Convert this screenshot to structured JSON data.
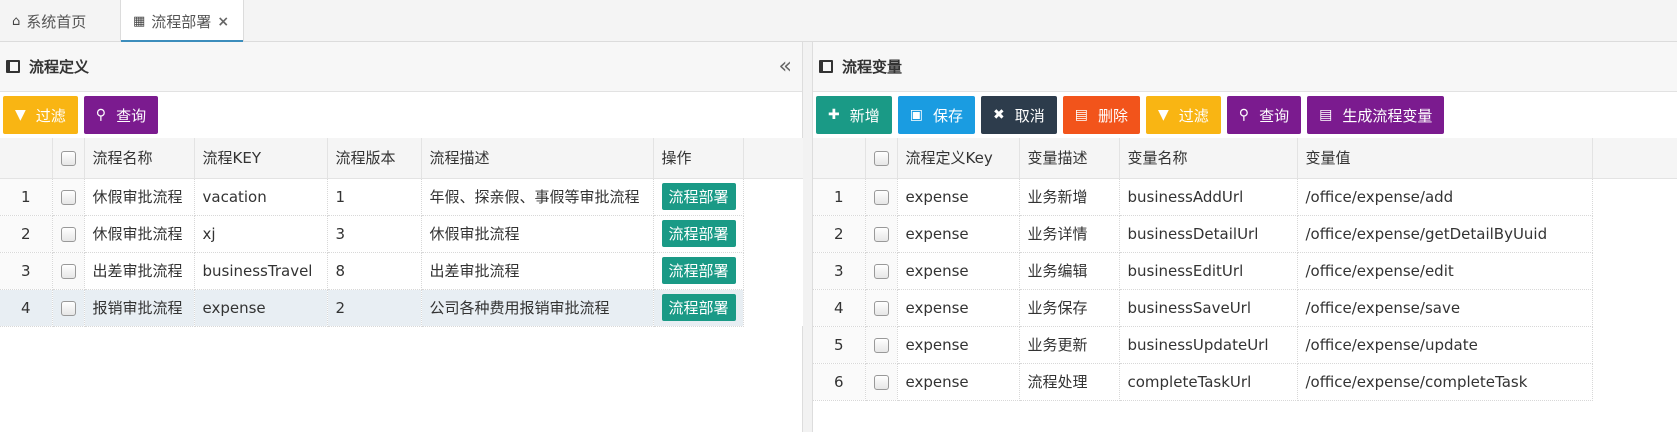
{
  "tabs": [
    {
      "label": "系统首页",
      "icon": "home-icon"
    },
    {
      "label": "流程部署",
      "icon": "sitemap-icon",
      "close": "×"
    }
  ],
  "left_panel": {
    "title": "流程定义",
    "collapse_symbol": "«",
    "buttons": [
      {
        "label": "过滤",
        "icon": "filter-icon",
        "color": "#f9b513"
      },
      {
        "label": "查询",
        "icon": "search-icon",
        "color": "#7b1b8f"
      }
    ],
    "columns": [
      "流程名称",
      "流程KEY",
      "流程版本",
      "流程描述",
      "操作"
    ],
    "rows": [
      {
        "no": "1",
        "name": "休假审批流程",
        "key": "vacation",
        "version": "1",
        "desc": "年假、探亲假、事假等审批流程",
        "action": "流程部署"
      },
      {
        "no": "2",
        "name": "休假审批流程",
        "key": "xj",
        "version": "3",
        "desc": "休假审批流程",
        "action": "流程部署"
      },
      {
        "no": "3",
        "name": "出差审批流程",
        "key": "businessTravel",
        "version": "8",
        "desc": "出差审批流程",
        "action": "流程部署"
      },
      {
        "no": "4",
        "name": "报销审批流程",
        "key": "expense",
        "version": "2",
        "desc": "公司各种费用报销审批流程",
        "action": "流程部署"
      }
    ]
  },
  "right_panel": {
    "title": "流程变量",
    "buttons": [
      {
        "label": "新增",
        "icon": "plus-icon",
        "color": "#1a9a86"
      },
      {
        "label": "保存",
        "icon": "save-icon",
        "color": "#1a9ce1"
      },
      {
        "label": "取消",
        "icon": "times-icon",
        "color": "#2d3c4c"
      },
      {
        "label": "删除",
        "icon": "file-icon",
        "color": "#f2541b"
      },
      {
        "label": "过滤",
        "icon": "filter-icon",
        "color": "#f9b513"
      },
      {
        "label": "查询",
        "icon": "search-icon",
        "color": "#7b1b8f"
      },
      {
        "label": "生成流程变量",
        "icon": "file-text-icon",
        "color": "#7b1b8f"
      }
    ],
    "columns": [
      "流程定义Key",
      "变量描述",
      "变量名称",
      "变量值"
    ],
    "rows": [
      {
        "no": "1",
        "def_key": "expense",
        "desc": "业务新增",
        "name": "businessAddUrl",
        "value": "/office/expense/add"
      },
      {
        "no": "2",
        "def_key": "expense",
        "desc": "业务详情",
        "name": "businessDetailUrl",
        "value": "/office/expense/getDetailByUuid"
      },
      {
        "no": "3",
        "def_key": "expense",
        "desc": "业务编辑",
        "name": "businessEditUrl",
        "value": "/office/expense/edit"
      },
      {
        "no": "4",
        "def_key": "expense",
        "desc": "业务保存",
        "name": "businessSaveUrl",
        "value": "/office/expense/save"
      },
      {
        "no": "5",
        "def_key": "expense",
        "desc": "业务更新",
        "name": "businessUpdateUrl",
        "value": "/office/expense/update"
      },
      {
        "no": "6",
        "def_key": "expense",
        "desc": "流程处理",
        "name": "completeTaskUrl",
        "value": "/office/expense/completeTask"
      }
    ]
  }
}
